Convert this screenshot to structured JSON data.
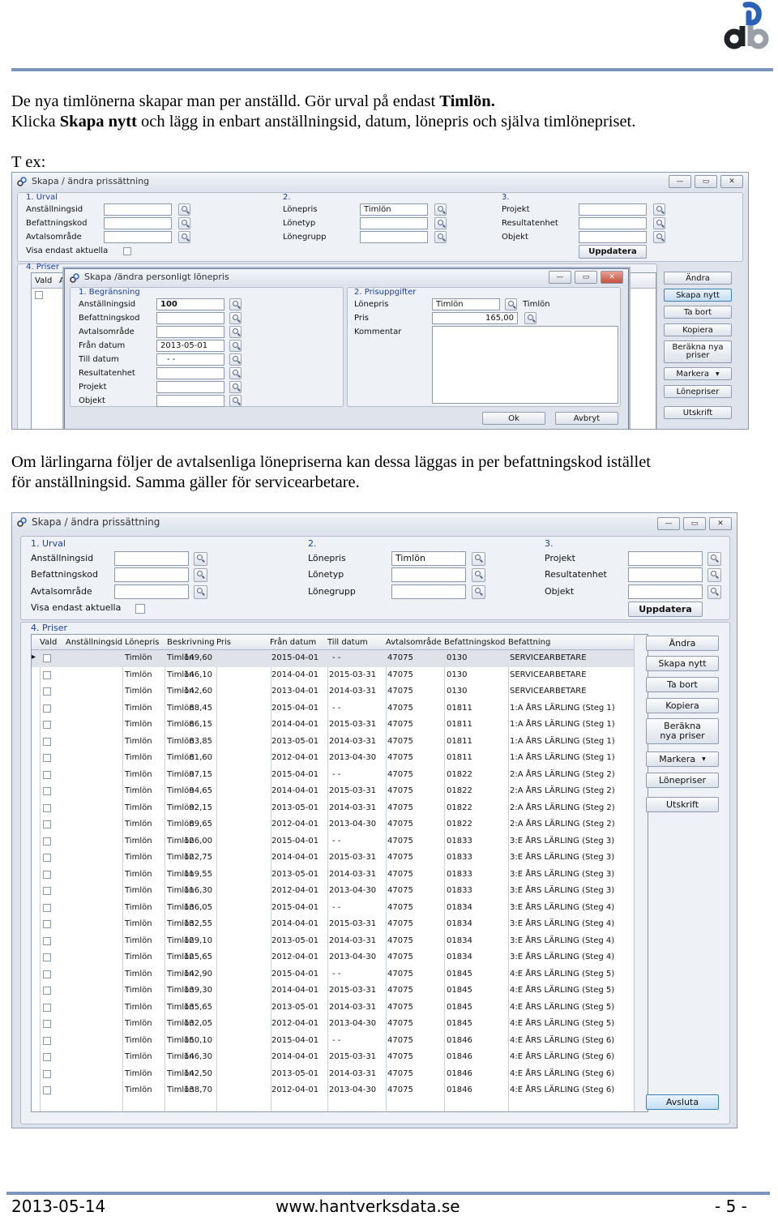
{
  "intro": {
    "line1_a": "De nya timlönerna skapar man per anställd. Gör urval på endast ",
    "line1_b": "Timlön.",
    "line2_a": "Klicka ",
    "line2_b": "Skapa nytt",
    "line2_c": " och lägg in enbart anställningsid, datum, lönepris och själva timlönepriset.",
    "tex": "T ex:"
  },
  "middle": {
    "line1": "Om lärlingarna följer de avtalsenliga lönepriserna kan dessa läggas in per befattningskod istället",
    "line2": "för anställningsid. Samma gäller för servicearbetare."
  },
  "main_window": {
    "title": "Skapa / ändra prissättning",
    "sec1": "1. Urval",
    "sec2": "2.",
    "sec3": "3.",
    "sec4": "4. Priser",
    "labels1": [
      "Anställningsid",
      "Befattningskod",
      "Avtalsområde"
    ],
    "visa": "Visa endast aktuella",
    "labels2": [
      "Lönepris",
      "Lönetyp",
      "Lönegrupp"
    ],
    "loneris_value": "Timlön",
    "labels3": [
      "Projekt",
      "Resultatenhet",
      "Objekt"
    ],
    "uppdatera": "Uppdatera",
    "side_buttons": [
      "Ändra",
      "Skapa nytt",
      "Ta bort",
      "Kopiera",
      "Beräkna nya priser",
      "Markera",
      "Lönepriser",
      "Utskrift"
    ],
    "avsluta": "Avsluta"
  },
  "dialog": {
    "title": "Skapa /ändra personligt lönepris",
    "sec1": "1. Begränsning",
    "sec2": "2. Prisuppgifter",
    "labels": [
      "Anställningsid",
      "Befattningskod",
      "Avtalsområde",
      "Från datum",
      "Till datum",
      "Resultatenhet",
      "Projekt",
      "Objekt"
    ],
    "anst_value": "100",
    "fran_value": "2013-05-01",
    "till_value": "- -",
    "pris_labels": [
      "Lönepris",
      "Pris",
      "Kommentar"
    ],
    "lonepris_value": "Timlön",
    "lonepris_desc": "Timlön",
    "pris_value": "165,00",
    "ok": "Ok",
    "avbryt": "Avbryt"
  },
  "grid": {
    "headers": [
      "Vald",
      "Anställningsid",
      "Lönepris",
      "Beskrivning",
      "Pris",
      "Från datum",
      "Till datum",
      "Avtalsområde",
      "Befattningskod",
      "Befattning"
    ],
    "small_headers": [
      "Vald",
      "A"
    ],
    "rows": [
      [
        "Timlön",
        "Timlön",
        "149,60",
        "2015-04-01",
        "- -",
        "47075",
        "0130",
        "SERVICEARBETARE"
      ],
      [
        "Timlön",
        "Timlön",
        "146,10",
        "2014-04-01",
        "2015-03-31",
        "47075",
        "0130",
        "SERVICEARBETARE"
      ],
      [
        "Timlön",
        "Timlön",
        "142,60",
        "2013-04-01",
        "2014-03-31",
        "47075",
        "0130",
        "SERVICEARBETARE"
      ],
      [
        "Timlön",
        "Timlön",
        "88,45",
        "2015-04-01",
        "- -",
        "47075",
        "01811",
        "1:A ÅRS LÄRLING (Steg 1)"
      ],
      [
        "Timlön",
        "Timlön",
        "86,15",
        "2014-04-01",
        "2015-03-31",
        "47075",
        "01811",
        "1:A ÅRS LÄRLING (Steg 1)"
      ],
      [
        "Timlön",
        "Timlön",
        "83,85",
        "2013-05-01",
        "2014-03-31",
        "47075",
        "01811",
        "1:A ÅRS LÄRLING (Steg 1)"
      ],
      [
        "Timlön",
        "Timlön",
        "81,60",
        "2012-04-01",
        "2013-04-30",
        "47075",
        "01811",
        "1:A ÅRS LÄRLING (Steg 1)"
      ],
      [
        "Timlön",
        "Timlön",
        "97,15",
        "2015-04-01",
        "- -",
        "47075",
        "01822",
        "2:A ÅRS LÄRLING (Steg 2)"
      ],
      [
        "Timlön",
        "Timlön",
        "94,65",
        "2014-04-01",
        "2015-03-31",
        "47075",
        "01822",
        "2:A ÅRS LÄRLING (Steg 2)"
      ],
      [
        "Timlön",
        "Timlön",
        "92,15",
        "2013-05-01",
        "2014-03-31",
        "47075",
        "01822",
        "2:A ÅRS LÄRLING (Steg 2)"
      ],
      [
        "Timlön",
        "Timlön",
        "89,65",
        "2012-04-01",
        "2013-04-30",
        "47075",
        "01822",
        "2:A ÅRS LÄRLING (Steg 2)"
      ],
      [
        "Timlön",
        "Timlön",
        "126,00",
        "2015-04-01",
        "- -",
        "47075",
        "01833",
        "3:E ÅRS LÄRLING (Steg 3)"
      ],
      [
        "Timlön",
        "Timlön",
        "122,75",
        "2014-04-01",
        "2015-03-31",
        "47075",
        "01833",
        "3:E ÅRS LÄRLING (Steg 3)"
      ],
      [
        "Timlön",
        "Timlön",
        "119,55",
        "2013-05-01",
        "2014-03-31",
        "47075",
        "01833",
        "3:E ÅRS LÄRLING (Steg 3)"
      ],
      [
        "Timlön",
        "Timlön",
        "116,30",
        "2012-04-01",
        "2013-04-30",
        "47075",
        "01833",
        "3:E ÅRS LÄRLING (Steg 3)"
      ],
      [
        "Timlön",
        "Timlön",
        "136,05",
        "2015-04-01",
        "- -",
        "47075",
        "01834",
        "3:E ÅRS LÄRLING (Steg 4)"
      ],
      [
        "Timlön",
        "Timlön",
        "132,55",
        "2014-04-01",
        "2015-03-31",
        "47075",
        "01834",
        "3:E ÅRS LÄRLING (Steg 4)"
      ],
      [
        "Timlön",
        "Timlön",
        "129,10",
        "2013-05-01",
        "2014-03-31",
        "47075",
        "01834",
        "3:E ÅRS LÄRLING (Steg 4)"
      ],
      [
        "Timlön",
        "Timlön",
        "125,65",
        "2012-04-01",
        "2013-04-30",
        "47075",
        "01834",
        "3:E ÅRS LÄRLING (Steg 4)"
      ],
      [
        "Timlön",
        "Timlön",
        "142,90",
        "2015-04-01",
        "- -",
        "47075",
        "01845",
        "4:E ÅRS LÄRLING (Steg 5)"
      ],
      [
        "Timlön",
        "Timlön",
        "139,30",
        "2014-04-01",
        "2015-03-31",
        "47075",
        "01845",
        "4:E ÅRS LÄRLING (Steg 5)"
      ],
      [
        "Timlön",
        "Timlön",
        "135,65",
        "2013-05-01",
        "2014-03-31",
        "47075",
        "01845",
        "4:E ÅRS LÄRLING (Steg 5)"
      ],
      [
        "Timlön",
        "Timlön",
        "132,05",
        "2012-04-01",
        "2013-04-30",
        "47075",
        "01845",
        "4:E ÅRS LÄRLING (Steg 5)"
      ],
      [
        "Timlön",
        "Timlön",
        "150,10",
        "2015-04-01",
        "- -",
        "47075",
        "01846",
        "4:E ÅRS LÄRLING (Steg 6)"
      ],
      [
        "Timlön",
        "Timlön",
        "146,30",
        "2014-04-01",
        "2015-03-31",
        "47075",
        "01846",
        "4:E ÅRS LÄRLING (Steg 6)"
      ],
      [
        "Timlön",
        "Timlön",
        "142,50",
        "2013-05-01",
        "2014-03-31",
        "47075",
        "01846",
        "4:E ÅRS LÄRLING (Steg 6)"
      ],
      [
        "Timlön",
        "Timlön",
        "138,70",
        "2012-04-01",
        "2013-04-30",
        "47075",
        "01846",
        "4:E ÅRS LÄRLING (Steg 6)"
      ]
    ]
  },
  "footer": {
    "date": "2013-05-14",
    "url": "www.hantverksdata.se",
    "page": "- 5 -"
  },
  "colors": {
    "accent": "#1a3f9c",
    "rule": "#7c95bd",
    "logo_dark": "#1f2328",
    "logo_blue": "#2a62b7"
  }
}
